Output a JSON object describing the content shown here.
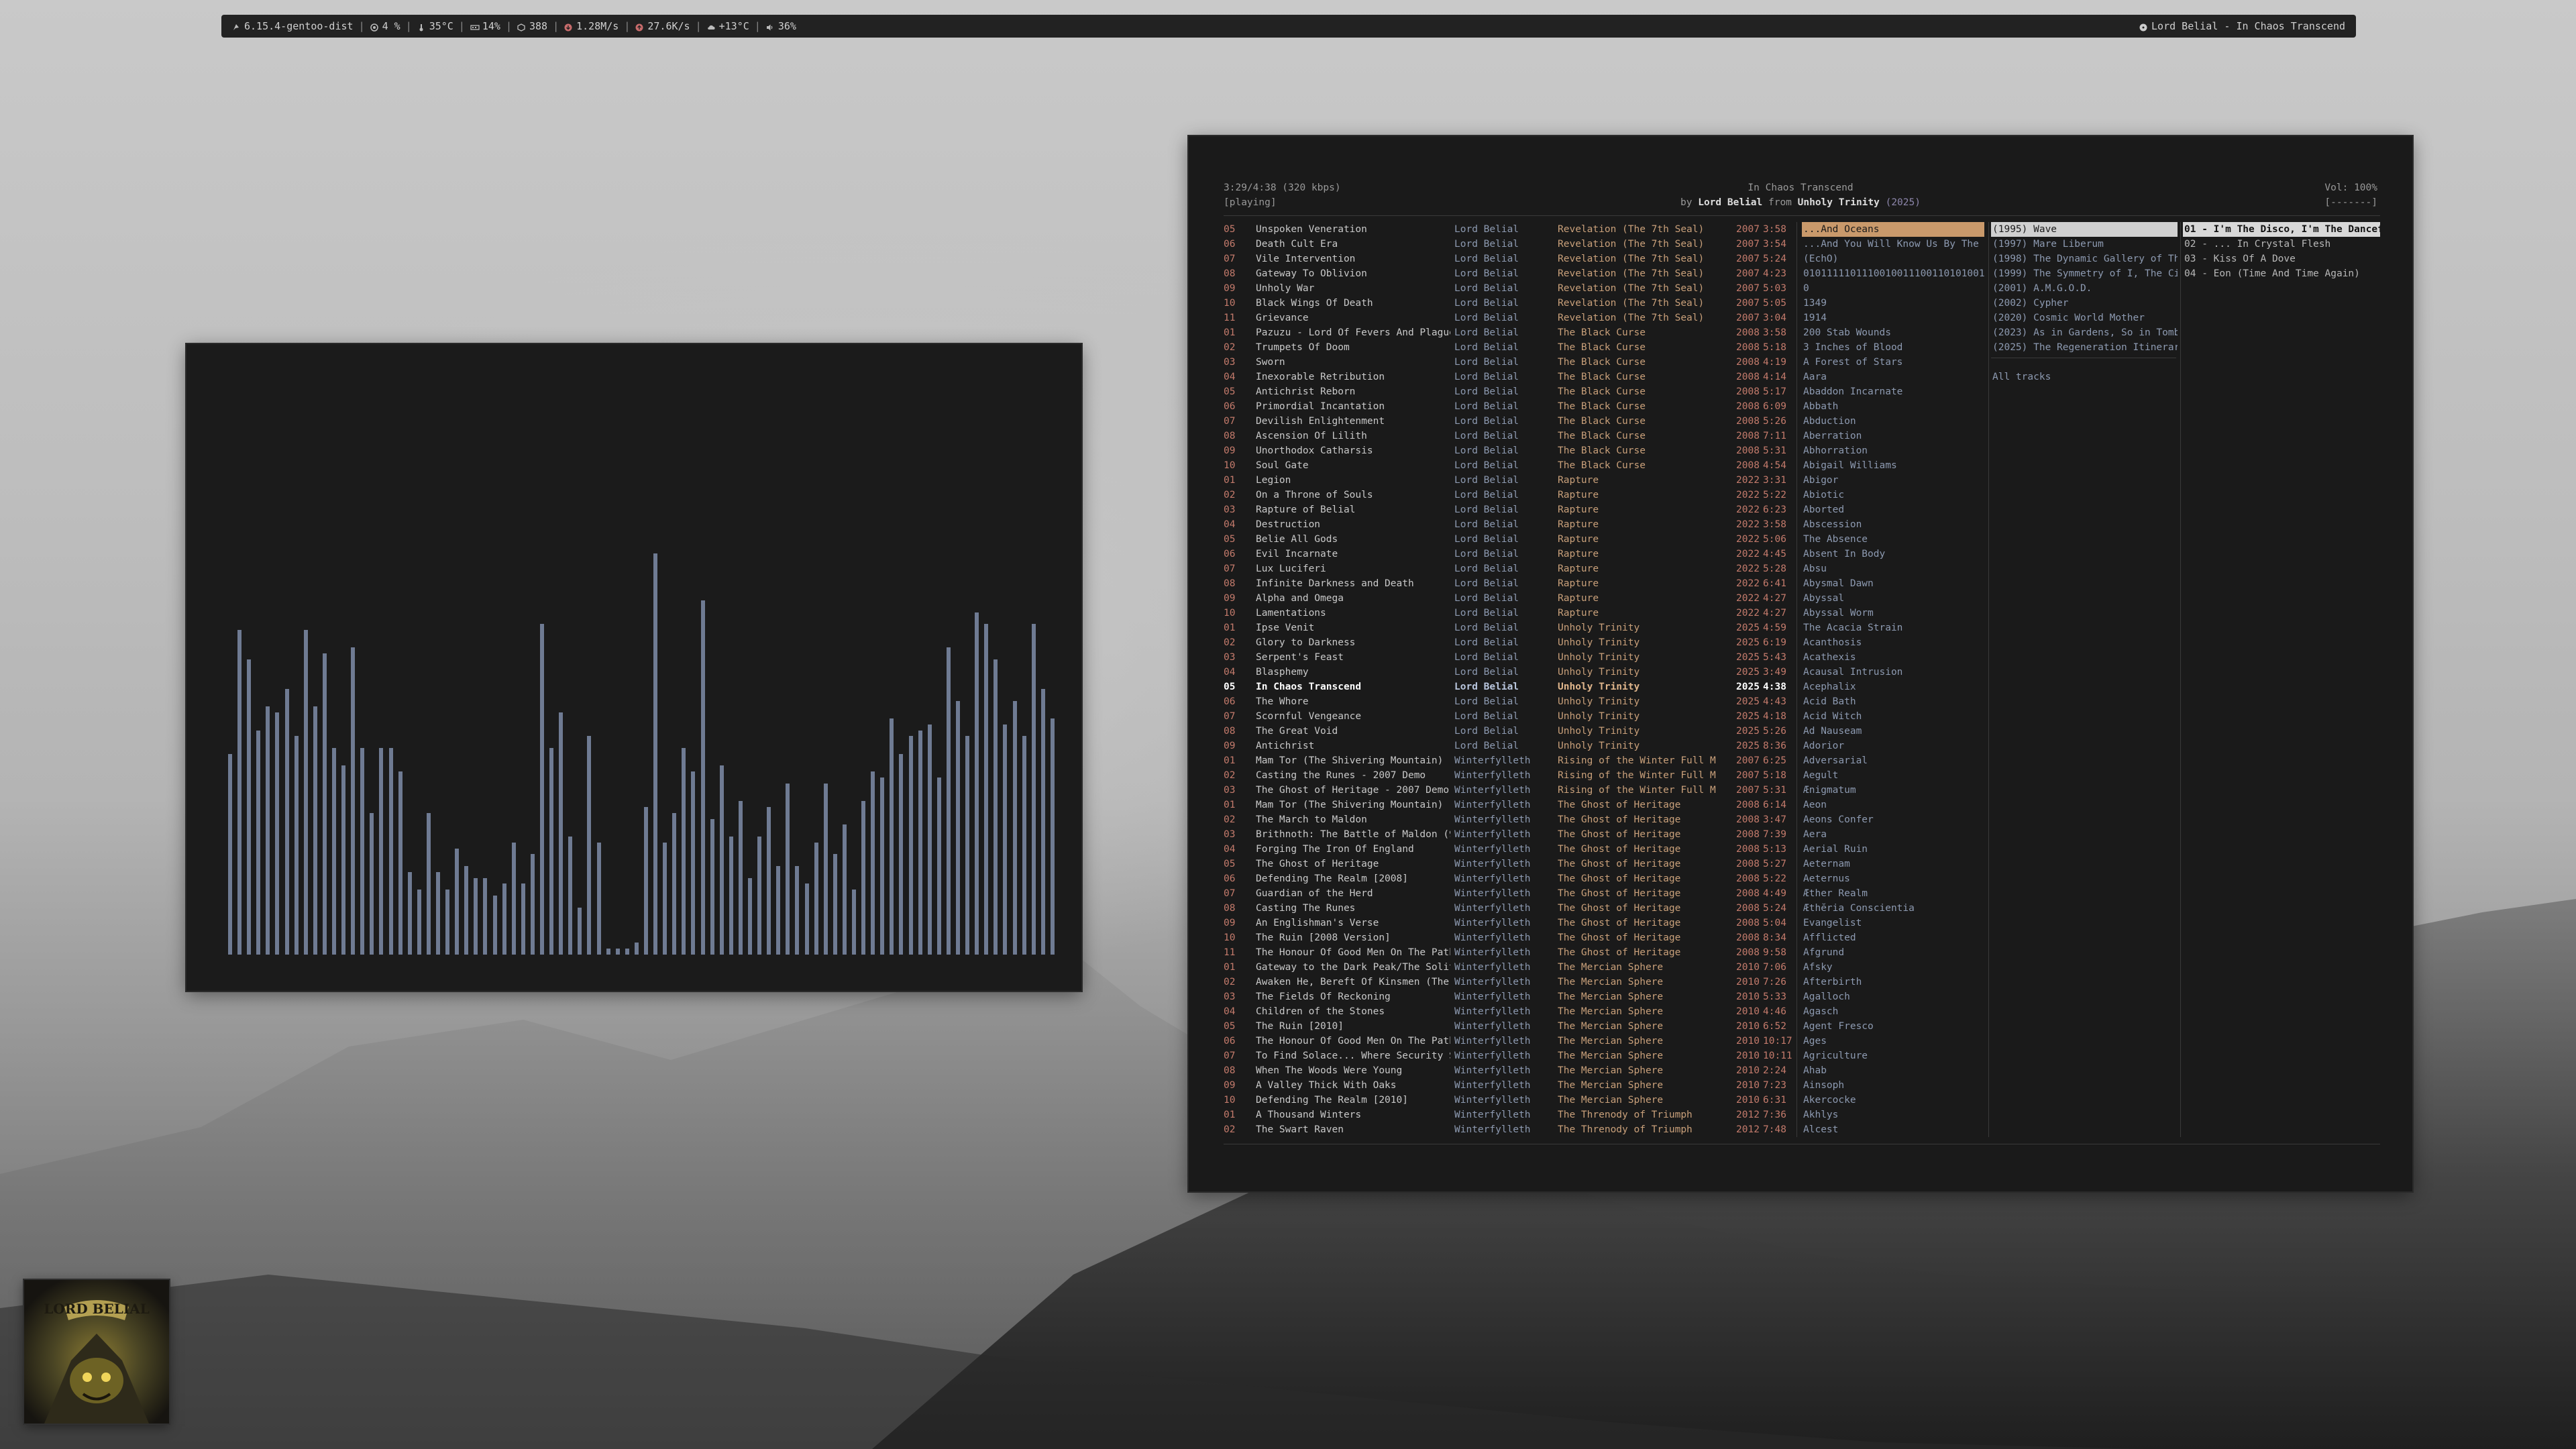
{
  "topbar": {
    "kernel": "6.15.4-gentoo-dist",
    "cpu": "4 %",
    "temp": "35°C",
    "mem": "14%",
    "pkgs": "388",
    "down": "1.28M/s",
    "up": "27.6K/s",
    "weather": "+13°C",
    "volume": "36%",
    "now_playing": "Lord Belial - In Chaos Transcend"
  },
  "player": {
    "position": "3:29/4:38 (320 kbps)",
    "state": "[playing]",
    "title": "In Chaos Transcend",
    "by_prefix": "by ",
    "artist": "Lord Belial",
    "from_word": " from ",
    "album": "Unholy Trinity",
    "year": "(2025)",
    "volume": "Vol: 100%",
    "volume_bar": "[-------]"
  },
  "tracks": [
    {
      "no": "05",
      "title": "Unspoken Veneration",
      "artist": "Lord Belial",
      "album": "Revelation (The 7th Seal)",
      "year": "2007",
      "dur": "3:58"
    },
    {
      "no": "06",
      "title": "Death Cult Era",
      "artist": "Lord Belial",
      "album": "Revelation (The 7th Seal)",
      "year": "2007",
      "dur": "3:54"
    },
    {
      "no": "07",
      "title": "Vile Intervention",
      "artist": "Lord Belial",
      "album": "Revelation (The 7th Seal)",
      "year": "2007",
      "dur": "5:24"
    },
    {
      "no": "08",
      "title": "Gateway To Oblivion",
      "artist": "Lord Belial",
      "album": "Revelation (The 7th Seal)",
      "year": "2007",
      "dur": "4:23"
    },
    {
      "no": "09",
      "title": "Unholy War",
      "artist": "Lord Belial",
      "album": "Revelation (The 7th Seal)",
      "year": "2007",
      "dur": "5:03"
    },
    {
      "no": "10",
      "title": "Black Wings Of Death",
      "artist": "Lord Belial",
      "album": "Revelation (The 7th Seal)",
      "year": "2007",
      "dur": "5:05"
    },
    {
      "no": "11",
      "title": "Grievance",
      "artist": "Lord Belial",
      "album": "Revelation (The 7th Seal)",
      "year": "2007",
      "dur": "3:04"
    },
    {
      "no": "01",
      "title": "Pazuzu - Lord Of Fevers And Plague",
      "artist": "Lord Belial",
      "album": "The Black Curse",
      "year": "2008",
      "dur": "3:58"
    },
    {
      "no": "02",
      "title": "Trumpets Of Doom",
      "artist": "Lord Belial",
      "album": "The Black Curse",
      "year": "2008",
      "dur": "5:18"
    },
    {
      "no": "03",
      "title": "Sworn",
      "artist": "Lord Belial",
      "album": "The Black Curse",
      "year": "2008",
      "dur": "4:19"
    },
    {
      "no": "04",
      "title": "Inexorable Retribution",
      "artist": "Lord Belial",
      "album": "The Black Curse",
      "year": "2008",
      "dur": "4:14"
    },
    {
      "no": "05",
      "title": "Antichrist Reborn",
      "artist": "Lord Belial",
      "album": "The Black Curse",
      "year": "2008",
      "dur": "5:17"
    },
    {
      "no": "06",
      "title": "Primordial Incantation",
      "artist": "Lord Belial",
      "album": "The Black Curse",
      "year": "2008",
      "dur": "6:09"
    },
    {
      "no": "07",
      "title": "Devilish Enlightenment",
      "artist": "Lord Belial",
      "album": "The Black Curse",
      "year": "2008",
      "dur": "5:26"
    },
    {
      "no": "08",
      "title": "Ascension Of Lilith",
      "artist": "Lord Belial",
      "album": "The Black Curse",
      "year": "2008",
      "dur": "7:11"
    },
    {
      "no": "09",
      "title": "Unorthodox Catharsis",
      "artist": "Lord Belial",
      "album": "The Black Curse",
      "year": "2008",
      "dur": "5:31"
    },
    {
      "no": "10",
      "title": "Soul Gate",
      "artist": "Lord Belial",
      "album": "The Black Curse",
      "year": "2008",
      "dur": "4:54"
    },
    {
      "no": "01",
      "title": "Legion",
      "artist": "Lord Belial",
      "album": "Rapture",
      "year": "2022",
      "dur": "3:31"
    },
    {
      "no": "02",
      "title": "On a Throne of Souls",
      "artist": "Lord Belial",
      "album": "Rapture",
      "year": "2022",
      "dur": "5:22"
    },
    {
      "no": "03",
      "title": "Rapture of Belial",
      "artist": "Lord Belial",
      "album": "Rapture",
      "year": "2022",
      "dur": "6:23"
    },
    {
      "no": "04",
      "title": "Destruction",
      "artist": "Lord Belial",
      "album": "Rapture",
      "year": "2022",
      "dur": "3:58"
    },
    {
      "no": "05",
      "title": "Belie All Gods",
      "artist": "Lord Belial",
      "album": "Rapture",
      "year": "2022",
      "dur": "5:06"
    },
    {
      "no": "06",
      "title": "Evil Incarnate",
      "artist": "Lord Belial",
      "album": "Rapture",
      "year": "2022",
      "dur": "4:45"
    },
    {
      "no": "07",
      "title": "Lux Luciferi",
      "artist": "Lord Belial",
      "album": "Rapture",
      "year": "2022",
      "dur": "5:28"
    },
    {
      "no": "08",
      "title": "Infinite Darkness and Death",
      "artist": "Lord Belial",
      "album": "Rapture",
      "year": "2022",
      "dur": "6:41"
    },
    {
      "no": "09",
      "title": "Alpha and Omega",
      "artist": "Lord Belial",
      "album": "Rapture",
      "year": "2022",
      "dur": "4:27"
    },
    {
      "no": "10",
      "title": "Lamentations",
      "artist": "Lord Belial",
      "album": "Rapture",
      "year": "2022",
      "dur": "4:27"
    },
    {
      "no": "01",
      "title": "Ipse Venit",
      "artist": "Lord Belial",
      "album": "Unholy Trinity",
      "year": "2025",
      "dur": "4:59"
    },
    {
      "no": "02",
      "title": "Glory to Darkness",
      "artist": "Lord Belial",
      "album": "Unholy Trinity",
      "year": "2025",
      "dur": "6:19"
    },
    {
      "no": "03",
      "title": "Serpent's Feast",
      "artist": "Lord Belial",
      "album": "Unholy Trinity",
      "year": "2025",
      "dur": "5:43"
    },
    {
      "no": "04",
      "title": "Blasphemy",
      "artist": "Lord Belial",
      "album": "Unholy Trinity",
      "year": "2025",
      "dur": "3:49"
    },
    {
      "no": "05",
      "title": "In Chaos Transcend",
      "artist": "Lord Belial",
      "album": "Unholy Trinity",
      "year": "2025",
      "dur": "4:38",
      "current": true
    },
    {
      "no": "06",
      "title": "The Whore",
      "artist": "Lord Belial",
      "album": "Unholy Trinity",
      "year": "2025",
      "dur": "4:43"
    },
    {
      "no": "07",
      "title": "Scornful Vengeance",
      "artist": "Lord Belial",
      "album": "Unholy Trinity",
      "year": "2025",
      "dur": "4:18"
    },
    {
      "no": "08",
      "title": "The Great Void",
      "artist": "Lord Belial",
      "album": "Unholy Trinity",
      "year": "2025",
      "dur": "5:26"
    },
    {
      "no": "09",
      "title": "Antichrist",
      "artist": "Lord Belial",
      "album": "Unholy Trinity",
      "year": "2025",
      "dur": "8:36"
    },
    {
      "no": "01",
      "title": "Mam Tor (The Shivering Mountain) - 2",
      "artist": "Winterfylleth",
      "album": "Rising of the Winter Full M",
      "year": "2007",
      "dur": "6:25"
    },
    {
      "no": "02",
      "title": "Casting the Runes - 2007 Demo",
      "artist": "Winterfylleth",
      "album": "Rising of the Winter Full M",
      "year": "2007",
      "dur": "5:18"
    },
    {
      "no": "03",
      "title": "The Ghost of Heritage - 2007 Demo",
      "artist": "Winterfylleth",
      "album": "Rising of the Winter Full M",
      "year": "2007",
      "dur": "5:31"
    },
    {
      "no": "01",
      "title": "Mam Tor (The Shivering Mountain)",
      "artist": "Winterfylleth",
      "album": "The Ghost of Heritage",
      "year": "2008",
      "dur": "6:14"
    },
    {
      "no": "02",
      "title": "The March to Maldon",
      "artist": "Winterfylleth",
      "album": "The Ghost of Heritage",
      "year": "2008",
      "dur": "3:47"
    },
    {
      "no": "03",
      "title": "Brithnoth: The Battle of Maldon (991",
      "artist": "Winterfylleth",
      "album": "The Ghost of Heritage",
      "year": "2008",
      "dur": "7:39"
    },
    {
      "no": "04",
      "title": "Forging The Iron Of England",
      "artist": "Winterfylleth",
      "album": "The Ghost of Heritage",
      "year": "2008",
      "dur": "5:13"
    },
    {
      "no": "05",
      "title": "The Ghost of Heritage",
      "artist": "Winterfylleth",
      "album": "The Ghost of Heritage",
      "year": "2008",
      "dur": "5:27"
    },
    {
      "no": "06",
      "title": "Defending The Realm [2008]",
      "artist": "Winterfylleth",
      "album": "The Ghost of Heritage",
      "year": "2008",
      "dur": "5:22"
    },
    {
      "no": "07",
      "title": "Guardian of the Herd",
      "artist": "Winterfylleth",
      "album": "The Ghost of Heritage",
      "year": "2008",
      "dur": "4:49"
    },
    {
      "no": "08",
      "title": "Casting The Runes",
      "artist": "Winterfylleth",
      "album": "The Ghost of Heritage",
      "year": "2008",
      "dur": "5:24"
    },
    {
      "no": "09",
      "title": "An Englishman's Verse",
      "artist": "Winterfylleth",
      "album": "The Ghost of Heritage",
      "year": "2008",
      "dur": "5:04"
    },
    {
      "no": "10",
      "title": "The Ruin [2008 Version]",
      "artist": "Winterfylleth",
      "album": "The Ghost of Heritage",
      "year": "2008",
      "dur": "8:34"
    },
    {
      "no": "11",
      "title": "The Honour Of Good Men On The Path T",
      "artist": "Winterfylleth",
      "album": "The Ghost of Heritage",
      "year": "2008",
      "dur": "9:58"
    },
    {
      "no": "01",
      "title": "Gateway to the Dark Peak/The Solitar",
      "artist": "Winterfylleth",
      "album": "The Mercian Sphere",
      "year": "2010",
      "dur": "7:06"
    },
    {
      "no": "02",
      "title": "Awaken He, Bereft Of Kinsmen (The Wa",
      "artist": "Winterfylleth",
      "album": "The Mercian Sphere",
      "year": "2010",
      "dur": "7:26"
    },
    {
      "no": "03",
      "title": "The Fields Of Reckoning",
      "artist": "Winterfylleth",
      "album": "The Mercian Sphere",
      "year": "2010",
      "dur": "5:33"
    },
    {
      "no": "04",
      "title": "Children of the Stones",
      "artist": "Winterfylleth",
      "album": "The Mercian Sphere",
      "year": "2010",
      "dur": "4:46"
    },
    {
      "no": "05",
      "title": "The Ruin [2010]",
      "artist": "Winterfylleth",
      "album": "The Mercian Sphere",
      "year": "2010",
      "dur": "6:52"
    },
    {
      "no": "06",
      "title": "The Honour Of Good Men On The Path T",
      "artist": "Winterfylleth",
      "album": "The Mercian Sphere",
      "year": "2010",
      "dur": "10:17"
    },
    {
      "no": "07",
      "title": "To Find Solace... Where Security Sta",
      "artist": "Winterfylleth",
      "album": "The Mercian Sphere",
      "year": "2010",
      "dur": "10:11"
    },
    {
      "no": "08",
      "title": "When The Woods Were Young",
      "artist": "Winterfylleth",
      "album": "The Mercian Sphere",
      "year": "2010",
      "dur": "2:24"
    },
    {
      "no": "09",
      "title": "A Valley Thick With Oaks",
      "artist": "Winterfylleth",
      "album": "The Mercian Sphere",
      "year": "2010",
      "dur": "7:23"
    },
    {
      "no": "10",
      "title": "Defending The Realm [2010]",
      "artist": "Winterfylleth",
      "album": "The Mercian Sphere",
      "year": "2010",
      "dur": "6:31"
    },
    {
      "no": "01",
      "title": "A Thousand Winters",
      "artist": "Winterfylleth",
      "album": "The Threnody of Triumph",
      "year": "2012",
      "dur": "7:36"
    },
    {
      "no": "02",
      "title": "The Swart Raven",
      "artist": "Winterfylleth",
      "album": "The Threnody of Triumph",
      "year": "2012",
      "dur": "7:48"
    }
  ],
  "artists": [
    "...And Oceans",
    "...And You Will Know Us By The Tra",
    "(EchO)",
    "0101111101110010011100110101001",
    "0",
    "1349",
    "1914",
    "200 Stab Wounds",
    "3 Inches of Blood",
    "A Forest of Stars",
    "Aara",
    "Abaddon Incarnate",
    "Abbath",
    "Abduction",
    "Aberration",
    "Abhorration",
    "Abigail Williams",
    "Abigor",
    "Abiotic",
    "Aborted",
    "Abscession",
    "The Absence",
    "Absent In Body",
    "Absu",
    "Abysmal Dawn",
    "Abyssal",
    "Abyssal Worm",
    "The Acacia Strain",
    "Acanthosis",
    "Acathexis",
    "Acausal Intrusion",
    "Acephalix",
    "Acid Bath",
    "Acid Witch",
    "Ad Nauseam",
    "Adorior",
    "Adversarial",
    "Aegult",
    "Ænigmatum",
    "Aeon",
    "Aeons Confer",
    "Aera",
    "Aerial Ruin",
    "Aeternam",
    "Aeternus",
    "Æther Realm",
    "Æthĕria Conscientia",
    "Evangelist",
    "Afflicted",
    "Afgrund",
    "Afsky",
    "Afterbirth",
    "Agalloch",
    "Agasch",
    "Agent Fresco",
    "Ages",
    "Agriculture",
    "Ahab",
    "Ainsoph",
    "Akercocke",
    "Akhlys",
    "Alcest"
  ],
  "albums": [
    "(1995) Wave",
    "(1997) Mare Liberum",
    "(1998) The Dynamic Gallery of Thoug",
    "(1999) The Symmetry of I, The Circl",
    "(2001) A.M.G.O.D.",
    "(2002) Cypher",
    "(2020) Cosmic World Mother",
    "(2023) As in Gardens, So in Tombs",
    "(2025) The Regeneration Itinerary"
  ],
  "albums_all": "All tracks",
  "songs": [
    "01 - I'm The Disco, I'm The Dancefloo",
    "02 - ... In Crystal Flesh",
    "03 - Kiss Of A Dove",
    "04 - Eon (Time And Time Again)"
  ],
  "visualizer": {
    "bar_color": "#6f7b93",
    "levels": [
      0.34,
      0.55,
      0.5,
      0.38,
      0.42,
      0.41,
      0.45,
      0.37,
      0.55,
      0.42,
      0.51,
      0.35,
      0.32,
      0.52,
      0.35,
      0.24,
      0.35,
      0.35,
      0.31,
      0.14,
      0.11,
      0.24,
      0.14,
      0.11,
      0.18,
      0.15,
      0.13,
      0.13,
      0.1,
      0.12,
      0.19,
      0.12,
      0.17,
      0.56,
      0.35,
      0.41,
      0.2,
      0.08,
      0.37,
      0.19,
      0.01,
      0.01,
      0.01,
      0.02,
      0.25,
      0.68,
      0.19,
      0.24,
      0.35,
      0.31,
      0.6,
      0.23,
      0.32,
      0.2,
      0.26,
      0.13,
      0.2,
      0.25,
      0.15,
      0.29,
      0.15,
      0.12,
      0.19,
      0.29,
      0.17,
      0.22,
      0.11,
      0.26,
      0.31,
      0.3,
      0.4,
      0.34,
      0.37,
      0.38,
      0.39,
      0.3,
      0.52,
      0.43,
      0.37,
      0.58,
      0.56,
      0.5,
      0.39,
      0.43,
      0.37,
      0.56,
      0.45,
      0.4
    ]
  },
  "album_art": {
    "text": "LORD BELIAL"
  },
  "colors": {
    "bar_bg": "#222222",
    "window_bg": "#1a1a1a",
    "track_number": "#c47b6c",
    "artist_column": "#8d9ab1",
    "album_column": "#c9a07a",
    "selected_artist": "#c9996b"
  }
}
